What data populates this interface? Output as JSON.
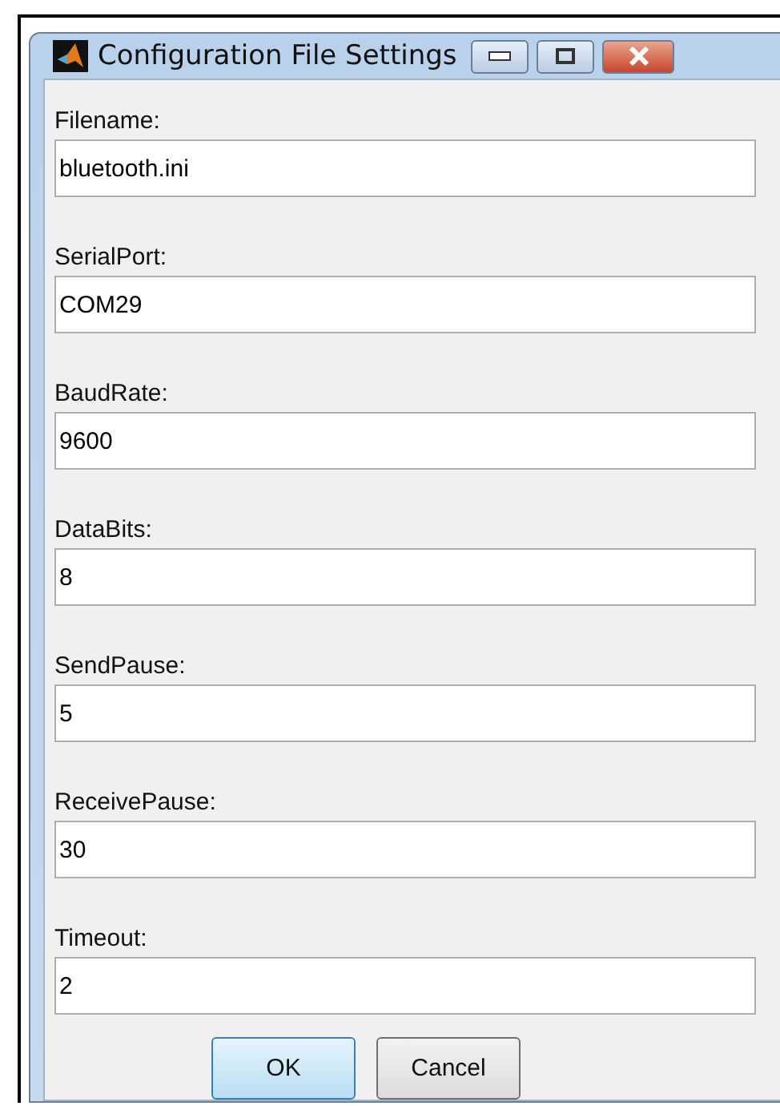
{
  "window": {
    "title": "Configuration File Settings"
  },
  "fields": [
    {
      "label": "Filename:",
      "value": "bluetooth.ini"
    },
    {
      "label": "SerialPort:",
      "value": "COM29"
    },
    {
      "label": "BaudRate:",
      "value": "9600"
    },
    {
      "label": "DataBits:",
      "value": "8"
    },
    {
      "label": "SendPause:",
      "value": "5"
    },
    {
      "label": "ReceivePause:",
      "value": "30"
    },
    {
      "label": "Timeout:",
      "value": "2"
    }
  ],
  "buttons": [
    {
      "label": "OK",
      "default": true
    },
    {
      "label": "Cancel",
      "default": false
    }
  ]
}
